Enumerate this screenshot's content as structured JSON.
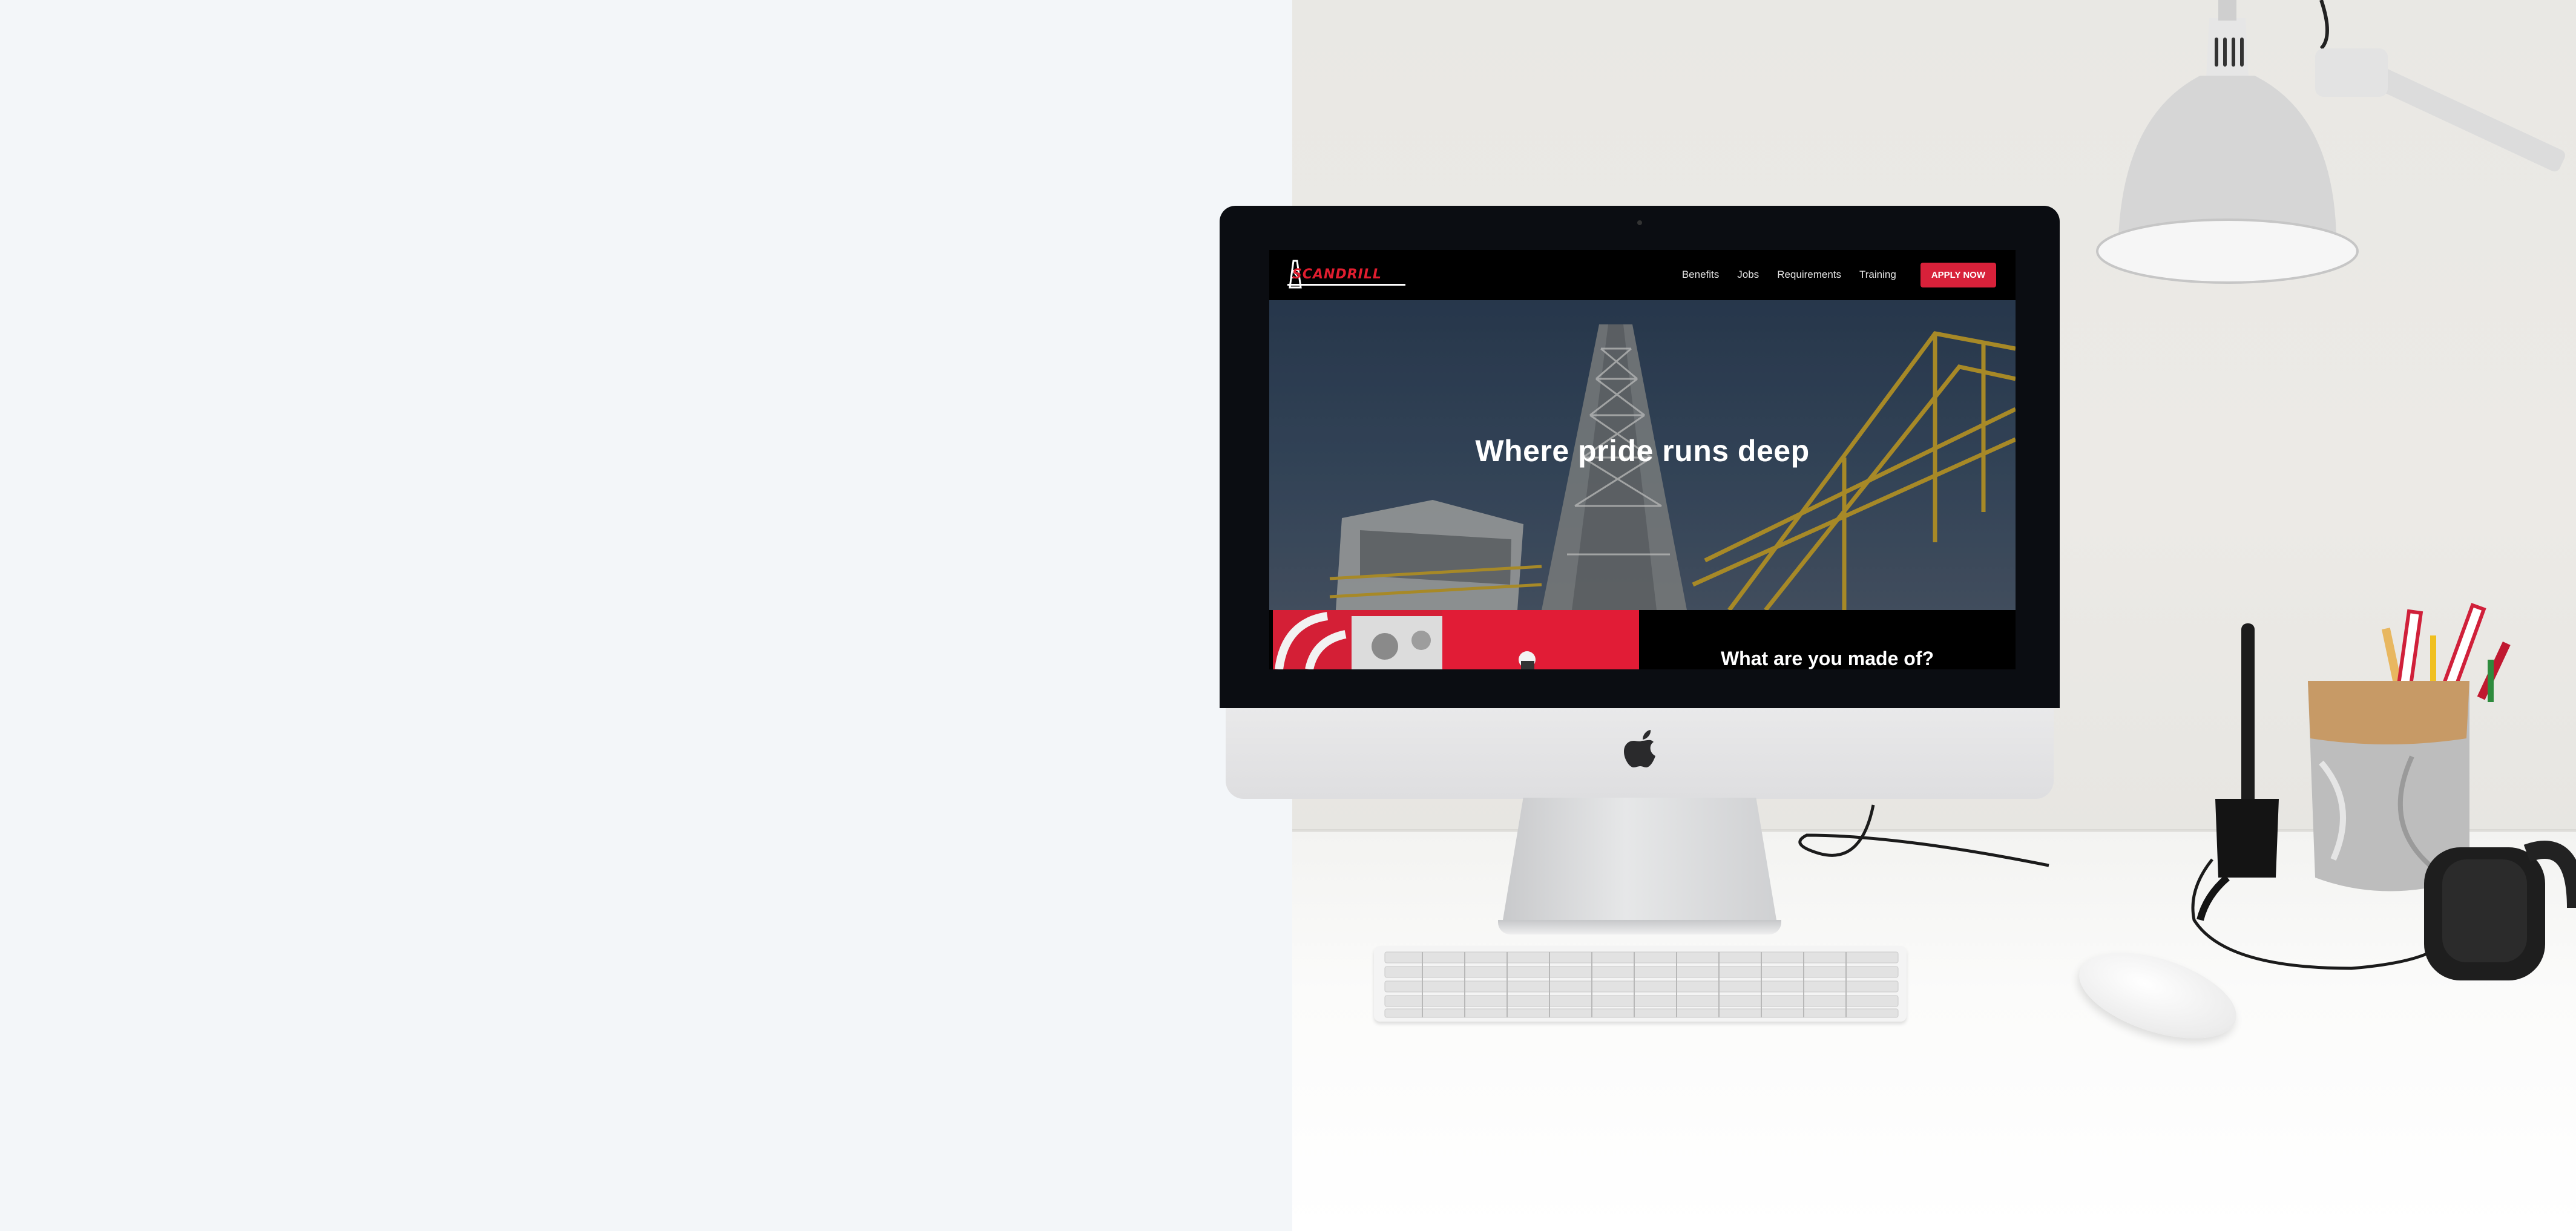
{
  "site": {
    "brand": "SCANDRILL",
    "nav": [
      "Benefits",
      "Jobs",
      "Requirements",
      "Training"
    ],
    "apply_label": "APPLY NOW",
    "hero_title": "Where pride runs deep",
    "section_heading": "What are you made of?"
  },
  "icons": {
    "logo": "derrick-logo-icon",
    "device": "apple-logo-icon"
  },
  "colors": {
    "page_background": "#f3f6f9",
    "brand_red": "#e11d2f",
    "nav_background": "#000000",
    "hero_sky": "#2c3d52",
    "rig_yellow": "#c9a227"
  }
}
